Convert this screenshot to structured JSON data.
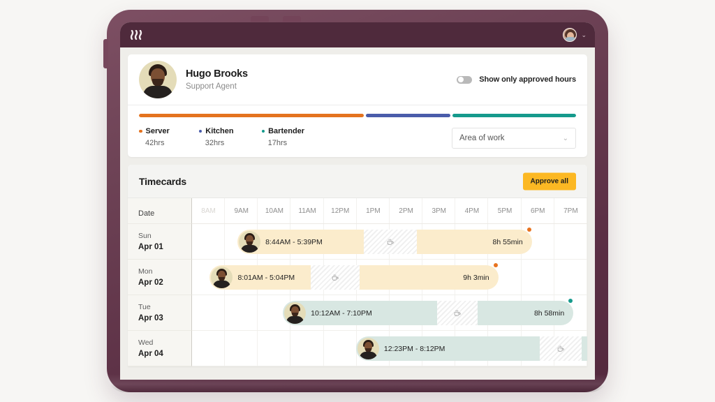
{
  "device": {
    "frame_color": "#5b2f44",
    "screen_bg": "#efeeea"
  },
  "appbar": {
    "logo_name": "app-logo",
    "avatar_name": "user-avatar",
    "chevron": "⌄"
  },
  "profile": {
    "name": "Hugo Brooks",
    "role": "Support Agent",
    "toggle_label": "Show only approved hours",
    "toggle_on": false
  },
  "breakdown": {
    "segments": [
      {
        "label": "Server",
        "hours": "42hrs",
        "color": "#e4731f",
        "pct": 52
      },
      {
        "label": "Kitchen",
        "hours": "32hrs",
        "color": "#4a5caa",
        "pct": 19.5
      },
      {
        "label": "Bartender",
        "hours": "17hrs",
        "color": "#159a8c",
        "pct": 28.5
      }
    ],
    "select_label": "Area of work",
    "select_chevron": "⌄"
  },
  "timecards": {
    "title": "Timecards",
    "approve_label": "Approve all",
    "date_column_header": "Date",
    "hours": [
      "8AM",
      "9AM",
      "10AM",
      "11AM",
      "12PM",
      "1PM",
      "2PM",
      "3PM",
      "4PM",
      "5PM",
      "6PM",
      "7PM"
    ],
    "rows": [
      {
        "dow": "Sun",
        "day": "Apr 01",
        "time_range": "8:44AM - 5:39PM",
        "duration": "8h 55min",
        "color": "#fbeccc",
        "status_color": "#e8731f",
        "start_pct": 11.5,
        "width_pct": 74.5,
        "break_start_pct": 43,
        "break_width_pct": 18,
        "break_icon": "coffee-cup-icon"
      },
      {
        "dow": "Mon",
        "day": "Apr 02",
        "time_range": "8:01AM - 5:04PM",
        "duration": "9h 3min",
        "color": "#fbeccc",
        "status_color": "#e8731f",
        "start_pct": 4.5,
        "width_pct": 73,
        "break_start_pct": 35,
        "break_width_pct": 17,
        "break_icon": "coffee-cup-icon"
      },
      {
        "dow": "Tue",
        "day": "Apr 03",
        "time_range": "10:12AM - 7:10PM",
        "duration": "8h 58min",
        "color": "#d8e7e2",
        "status_color": "#159a8c",
        "start_pct": 23,
        "width_pct": 73.5,
        "break_start_pct": 53,
        "break_width_pct": 14,
        "break_icon": "coffee-cup-icon"
      },
      {
        "dow": "Wed",
        "day": "Apr 04",
        "time_range": "12:23PM - 8:12PM",
        "duration": "",
        "color": "#d8e7e2",
        "status_color": "",
        "start_pct": 41.5,
        "width_pct": 62,
        "break_start_pct": 75,
        "break_width_pct": 17,
        "break_icon": "coffee-cup-icon"
      }
    ]
  }
}
